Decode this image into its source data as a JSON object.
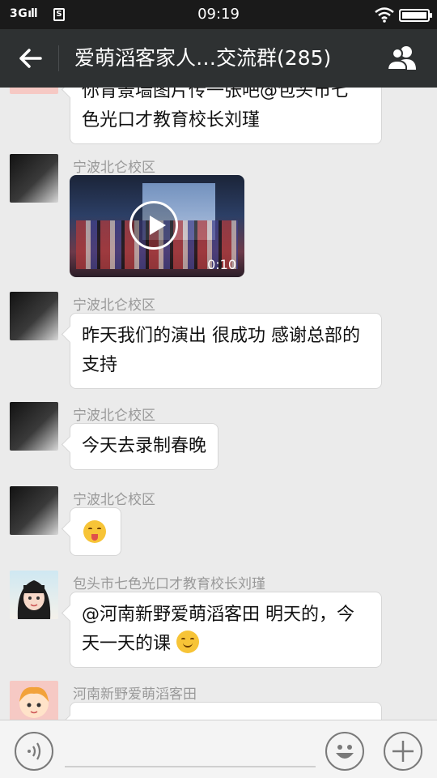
{
  "status_bar": {
    "signal": "3G",
    "sim_label": "S",
    "time": "09:19"
  },
  "header": {
    "title": "爱萌滔客家人…交流群(285)",
    "back_icon": "arrow-left-icon",
    "members_icon": "group-icon"
  },
  "messages": [
    {
      "type": "text",
      "sender": "",
      "lines": [
        "你肯景墙图片传一张吧@包头市七",
        "色光口才教育校长刘瑾"
      ]
    },
    {
      "type": "video",
      "sender": "宁波北仑校区",
      "duration": "0:10"
    },
    {
      "type": "text",
      "sender": "宁波北仑校区",
      "lines": [
        "昨天我们的演出 很成功 感谢总部的",
        "支持"
      ]
    },
    {
      "type": "text",
      "sender": "宁波北仑校区",
      "lines": [
        "今天去录制春晚"
      ]
    },
    {
      "type": "emoji",
      "sender": "宁波北仑校区",
      "emoji": "tongue-wink-emoji"
    },
    {
      "type": "text",
      "sender": "包头市七色光口才教育校长刘瑾",
      "lines": [
        "@河南新野爱萌滔客田 明天的，今",
        "天一天的课"
      ],
      "emoji": "smile-emoji"
    },
    {
      "type": "text",
      "sender": "河南新野爱萌滔客田",
      "lines": [
        ""
      ]
    }
  ],
  "input_bar": {
    "voice_icon": "voice-icon",
    "emoji_icon": "emoji-icon",
    "add_icon": "plus-icon"
  }
}
